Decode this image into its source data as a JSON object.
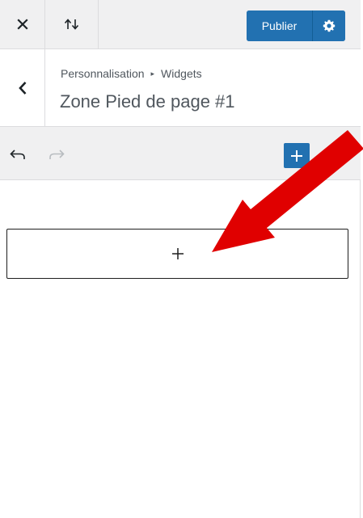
{
  "header": {
    "close_icon": "close-icon",
    "reorder_icon": "arrows-up-down-icon",
    "publish_label": "Publier",
    "settings_icon": "gear-icon"
  },
  "section": {
    "back_icon": "chevron-left-icon",
    "breadcrumb": {
      "parent": "Personnalisation",
      "separator": "▸",
      "current": "Widgets"
    },
    "title": "Zone Pied de page #1"
  },
  "toolbar": {
    "undo_icon": "undo-icon",
    "redo_icon": "redo-icon",
    "inserter_icon": "plus-icon"
  },
  "content": {
    "add_block_icon": "plus-icon"
  },
  "annotation": {
    "arrow_color": "#e00000"
  },
  "colors": {
    "accent": "#2271b1",
    "bar_background": "#f0f0f1",
    "border": "#dcdcde",
    "muted_text": "#50575e"
  }
}
